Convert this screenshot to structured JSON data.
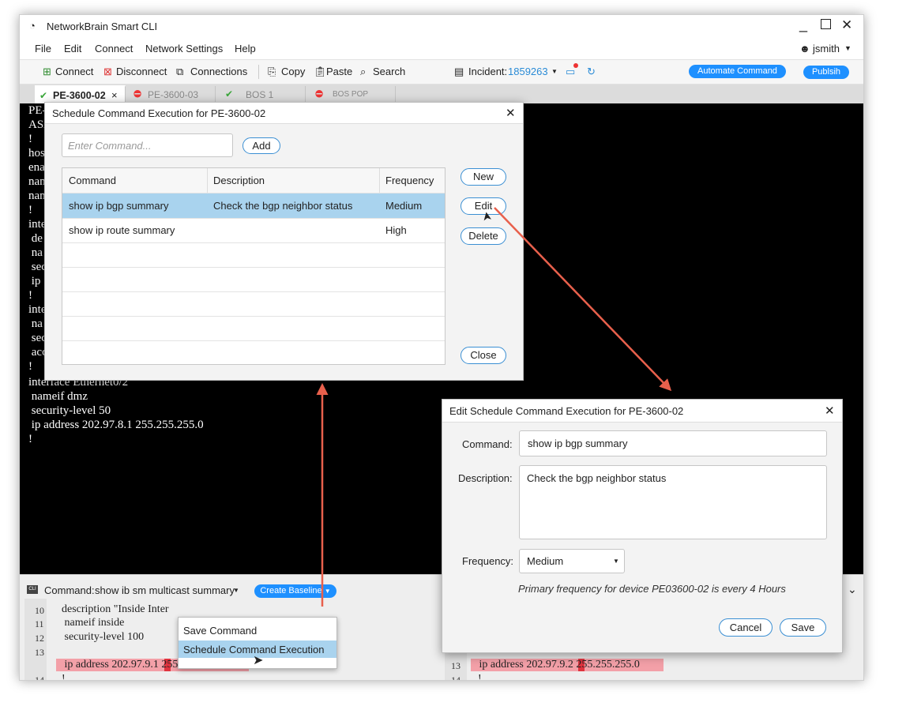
{
  "window": {
    "title": "NetworkBrain Smart CLI"
  },
  "menu": [
    "File",
    "Edit",
    "Connect",
    "Network Settings",
    "Help"
  ],
  "user": "jsmith",
  "toolbar": {
    "connect": "Connect",
    "disconnect": "Disconnect",
    "connections": "Connections",
    "copy": "Copy",
    "paste": "Paste",
    "search": "Search",
    "incident_label": "Incident:",
    "incident_value": "1859263",
    "automate": "Automate Command",
    "publish": "Publsih"
  },
  "tabs": [
    {
      "label": "PE-3600-02",
      "status": "ok",
      "close": "×"
    },
    {
      "label": "PE-3600-03",
      "status": "error"
    },
    {
      "label": "BOS 1",
      "status": "ok"
    },
    {
      "label": "BOS POP",
      "status": "error"
    }
  ],
  "terminal": {
    "lines": [
      "PE-",
      "ASA",
      "!",
      "hos",
      "ena",
      "nan",
      "nan",
      "!",
      "inte",
      " de",
      " na",
      " sec",
      " ip",
      "!",
      "inte",
      " na",
      " sec",
      " acc",
      "!",
      "interface Ethernet0/2",
      " nameif dmz",
      " security-level 50",
      " ip address 202.97.8.1 255.255.255.0",
      "!"
    ]
  },
  "bottom": {
    "command_label": "Command:",
    "command_value": "show ib sm multicast summary",
    "create_baseline": "Create Baseline",
    "left_lines": [
      {
        "n": "10",
        "t": "description \"Inside Inter"
      },
      {
        "n": "11",
        "t": " nameif inside"
      },
      {
        "n": "12",
        "t": " security-level 100"
      },
      {
        "n": "13",
        "t": " ip address 202.97.9.1 255.255.255.0"
      },
      {
        "n": "14",
        "t": "!"
      }
    ],
    "right_lines": [
      {
        "n": "13",
        "t": " ip address 202.97.9.2 255.255.255.0"
      },
      {
        "n": "14",
        "t": "!"
      }
    ],
    "menu": [
      "Save Command",
      "Schedule Command Execution"
    ]
  },
  "schedule_dialog": {
    "title": "Schedule Command Execution for PE-3600-02",
    "input_placeholder": "Enter Command...",
    "add": "Add",
    "columns": [
      "Command",
      "Description",
      "Frequency"
    ],
    "rows": [
      {
        "command": "show ip bgp summary",
        "description": "Check the bgp neighbor status",
        "frequency": "Medium"
      },
      {
        "command": "show ip route summary",
        "description": "",
        "frequency": "High"
      }
    ],
    "new": "New",
    "edit": "Edit",
    "delete": "Delete",
    "close": "Close"
  },
  "edit_dialog": {
    "title": "Edit Schedule Command Execution for PE-3600-02",
    "command_label": "Command:",
    "command_value": "show ip bgp summary",
    "description_label": "Description:",
    "description_value": "Check the bgp neighbor status",
    "frequency_label": "Frequency:",
    "frequency_value": "Medium",
    "note": "Primary frequency for device PE03600-02 is every 4 Hours",
    "cancel": "Cancel",
    "save": "Save"
  },
  "colors": {
    "accent": "#1e90ff",
    "selection": "#a9d3ee",
    "arrow": "#e8604c",
    "highlight": "#f3a0a8"
  }
}
